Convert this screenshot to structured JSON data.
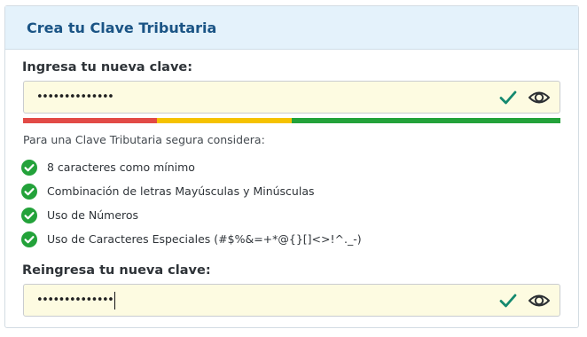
{
  "header": {
    "title": "Crea tu Clave Tributaria"
  },
  "new_password": {
    "label": "Ingresa tu nueva clave:",
    "value": "••••••••••••••",
    "valid_icon": "check-icon",
    "toggle_icon": "eye-icon"
  },
  "strength": {
    "level": "strong",
    "colors": [
      "#e24a46",
      "#f5c200",
      "#23a23a"
    ]
  },
  "requirements": {
    "title": "Para una Clave Tributaria segura considera:",
    "items": [
      {
        "label": "8 caracteres como mínimo",
        "met": true
      },
      {
        "label": "Combinación de letras Mayúsculas y Minúsculas",
        "met": true
      },
      {
        "label": "Uso de Números",
        "met": true
      },
      {
        "label": "Uso de Caracteres Especiales (#$%&=+*@{}[]<>!^._-)",
        "met": true
      }
    ]
  },
  "confirm_password": {
    "label": "Reingresa tu nueva clave:",
    "value": "••••••••••••••",
    "valid_icon": "check-icon",
    "toggle_icon": "eye-icon"
  },
  "colors": {
    "accent": "#1a5485",
    "success": "#23a23a",
    "input_bg": "#fdfbe1",
    "header_bg": "#e4f2fb"
  }
}
